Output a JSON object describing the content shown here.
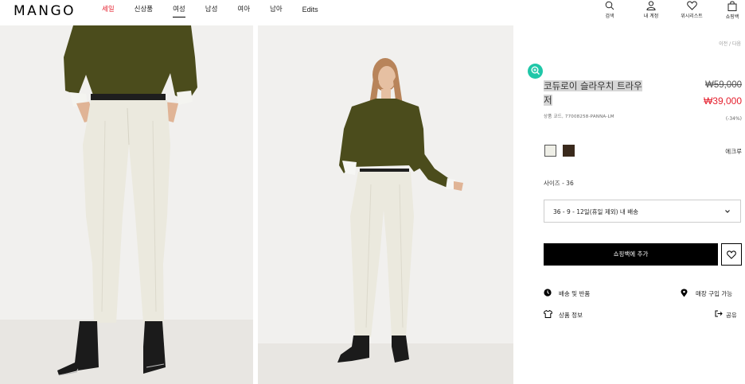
{
  "header": {
    "logo": "MANGO",
    "nav": [
      "세일",
      "신상품",
      "여성",
      "남성",
      "여아",
      "남아",
      "Edits"
    ],
    "icons": {
      "search": "검색",
      "account": "내 계정",
      "wishlist": "위시리스트",
      "bag": "쇼핑백"
    }
  },
  "gallery": {
    "left_image": "trousers-closeup-photo",
    "right_image": "model-full-body-photo"
  },
  "product": {
    "breadcrumb": "이전 / 다음",
    "title_line1": "코듀로이 슬라우치 트라우",
    "title_line2": "저",
    "price_original": "₩59,000",
    "price_sale": "₩39,000",
    "code": "상품 코드, 77008258-PANNA-LM",
    "discount": "(-34%)",
    "colors": [
      "#efefe7",
      "#3a2a1c"
    ],
    "color_name": "에크루",
    "size_label": "사이즈 - 36",
    "size_select": "36 - 9 - 12일(휴일 제외) 내 배송",
    "add_button": "쇼핑백에 추가",
    "shipping": "배송 및 반품",
    "store": "매장 구입 가능",
    "details": "상품 정보",
    "share": "공유"
  },
  "colors": {
    "accent_sale": "#e5202e",
    "zoom_badge": "#1fc7a8"
  }
}
